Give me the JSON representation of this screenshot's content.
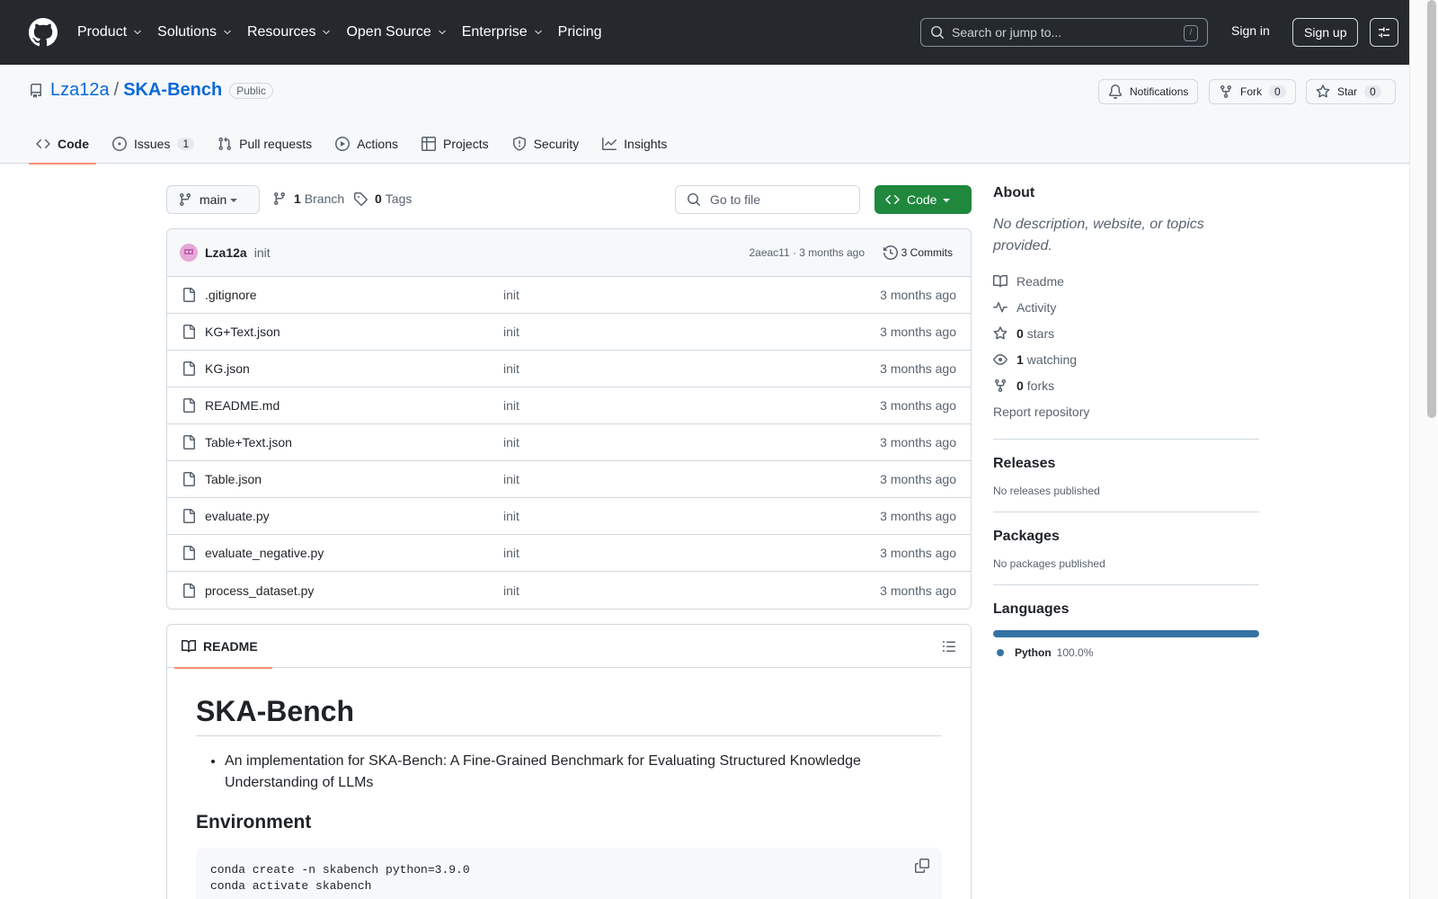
{
  "header": {
    "nav": [
      "Product",
      "Solutions",
      "Resources",
      "Open Source",
      "Enterprise",
      "Pricing"
    ],
    "search_placeholder": "Search or jump to...",
    "search_shortcut": "/",
    "signin": "Sign in",
    "signup": "Sign up"
  },
  "repo": {
    "owner": "Lza12a",
    "separator": "/",
    "name": "SKA-Bench",
    "visibility": "Public",
    "notifications_label": "Notifications",
    "fork_label": "Fork",
    "fork_count": "0",
    "star_label": "Star",
    "star_count": "0"
  },
  "tabs": [
    {
      "label": "Code",
      "count": "",
      "icon": "code-icon"
    },
    {
      "label": "Issues",
      "count": "1",
      "icon": "issue-opened-icon"
    },
    {
      "label": "Pull requests",
      "count": "",
      "icon": "git-pull-request-icon"
    },
    {
      "label": "Actions",
      "count": "",
      "icon": "play-icon"
    },
    {
      "label": "Projects",
      "count": "",
      "icon": "table-icon"
    },
    {
      "label": "Security",
      "count": "",
      "icon": "shield-icon"
    },
    {
      "label": "Insights",
      "count": "",
      "icon": "graph-icon"
    }
  ],
  "toolbar": {
    "branch": "main",
    "branch_count": "1",
    "branch_label": "Branch",
    "tag_count": "0",
    "tag_label": "Tags",
    "goto_placeholder": "Go to file",
    "code_button": "Code"
  },
  "commit": {
    "user": "Lza12a",
    "message": "init",
    "sha_time": "2aeac11 · 3 months ago",
    "commits_label": "3 Commits"
  },
  "files": [
    {
      "name": ".gitignore",
      "message": "init",
      "date": "3 months ago"
    },
    {
      "name": "KG+Text.json",
      "message": "init",
      "date": "3 months ago"
    },
    {
      "name": "KG.json",
      "message": "init",
      "date": "3 months ago"
    },
    {
      "name": "README.md",
      "message": "init",
      "date": "3 months ago"
    },
    {
      "name": "Table+Text.json",
      "message": "init",
      "date": "3 months ago"
    },
    {
      "name": "Table.json",
      "message": "init",
      "date": "3 months ago"
    },
    {
      "name": "evaluate.py",
      "message": "init",
      "date": "3 months ago"
    },
    {
      "name": "evaluate_negative.py",
      "message": "init",
      "date": "3 months ago"
    },
    {
      "name": "process_dataset.py",
      "message": "init",
      "date": "3 months ago"
    }
  ],
  "readme": {
    "tab_label": "README",
    "title": "SKA-Bench",
    "bullet": "An implementation for SKA-Bench: A Fine-Grained Benchmark for Evaluating Structured Knowledge Understanding of LLMs",
    "env_heading": "Environment",
    "code_line1": "conda create -n skabench python=3.9.0",
    "code_line2": "conda activate skabench"
  },
  "about": {
    "heading": "About",
    "description": "No description, website, or topics provided.",
    "readme": "Readme",
    "activity": "Activity",
    "stars_count": "0",
    "stars_label": "stars",
    "watching_count": "1",
    "watching_label": "watching",
    "forks_count": "0",
    "forks_label": "forks",
    "report": "Report repository"
  },
  "releases": {
    "heading": "Releases",
    "text": "No releases published"
  },
  "packages": {
    "heading": "Packages",
    "text": "No packages published"
  },
  "languages": {
    "heading": "Languages",
    "name": "Python",
    "percent": "100.0%",
    "fraction": 1.0,
    "color": "#3572a5"
  },
  "colors": {
    "header_bg": "#25292e",
    "link": "#0969da",
    "primary_button": "#1f883d",
    "tab_underline": "#fd8c73"
  }
}
